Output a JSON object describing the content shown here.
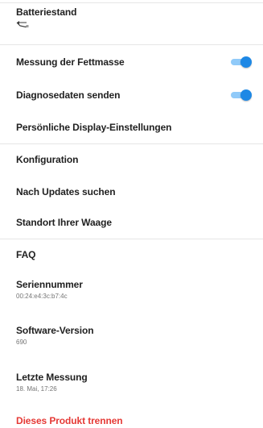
{
  "settings": {
    "battery": {
      "label": "Batteriestand",
      "icon": "battery-empty-icon"
    },
    "fat_mass": {
      "label": "Messung der Fettmasse",
      "enabled": true
    },
    "diagnostics": {
      "label": "Diagnosedaten senden",
      "enabled": true
    },
    "display": {
      "label": "Persönliche Display-Einstellungen"
    },
    "configuration": {
      "label": "Konfiguration"
    },
    "updates": {
      "label": "Nach Updates suchen"
    },
    "location": {
      "label": "Standort Ihrer Waage"
    },
    "faq": {
      "label": "FAQ"
    },
    "serial": {
      "label": "Seriennummer",
      "value": "00:24:e4:3c:b7:4c"
    },
    "software": {
      "label": "Software-Version",
      "value": "690"
    },
    "last_measurement": {
      "label": "Letzte Messung",
      "value": "18. Mai, 17:26"
    },
    "disconnect": {
      "label": "Dieses Produkt trennen"
    }
  },
  "colors": {
    "text": "#212121",
    "secondary": "#757575",
    "accent": "#1e88e5",
    "accent_track": "#90caf9",
    "danger": "#e53935",
    "divider": "#e6e6e6"
  }
}
